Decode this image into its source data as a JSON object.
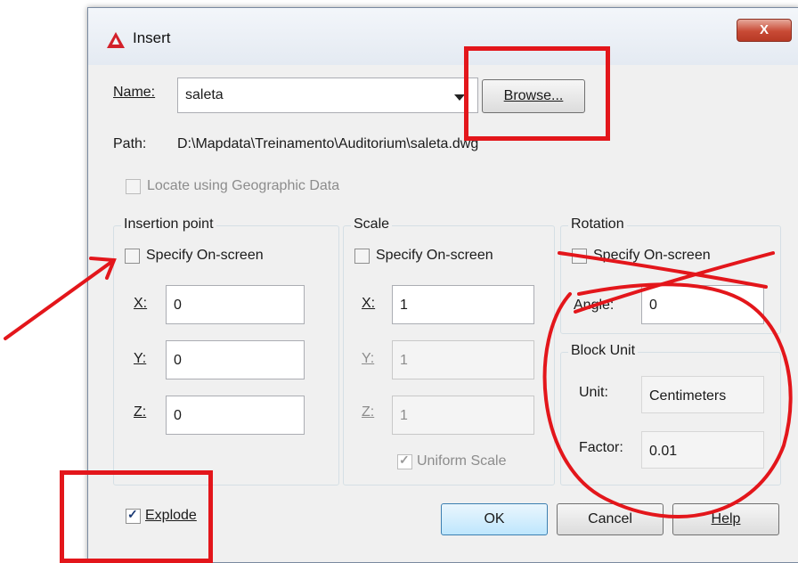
{
  "window": {
    "title": "Insert",
    "close_glyph": "X"
  },
  "name": {
    "label": "Name:",
    "value": "saleta",
    "browse_label": "Browse..."
  },
  "path": {
    "label": "Path:",
    "value": "D:\\Mapdata\\Treinamento\\Auditorium\\saleta.dwg"
  },
  "geographic": {
    "label": "Locate using Geographic Data",
    "checked": false
  },
  "insertion": {
    "title": "Insertion point",
    "specify_label": "Specify On-screen",
    "x_label": "X:",
    "x_value": "0",
    "y_label": "Y:",
    "y_value": "0",
    "z_label": "Z:",
    "z_value": "0"
  },
  "scale": {
    "title": "Scale",
    "specify_label": "Specify On-screen",
    "x_label": "X:",
    "x_value": "1",
    "y_label": "Y:",
    "y_value": "1",
    "z_label": "Z:",
    "z_value": "1",
    "uniform_label": "Uniform Scale",
    "uniform_checked": true
  },
  "rotation": {
    "title": "Rotation",
    "specify_label": "Specify On-screen",
    "angle_label": "Angle:",
    "angle_value": "0"
  },
  "block_unit": {
    "title": "Block Unit",
    "unit_label": "Unit:",
    "unit_value": "Centimeters",
    "factor_label": "Factor:",
    "factor_value": "0.01"
  },
  "explode": {
    "label": "Explode",
    "checked": true
  },
  "buttons": {
    "ok": "OK",
    "cancel": "Cancel",
    "help": "Help"
  },
  "colors": {
    "annotation": "#e3161b",
    "title_gradient": "#e4eaf2",
    "dialog_bg": "#f0f0f0"
  },
  "icons": [
    "autocad-logo-icon",
    "close-icon",
    "dropdown-arrow-icon",
    "checkbox-icon"
  ]
}
